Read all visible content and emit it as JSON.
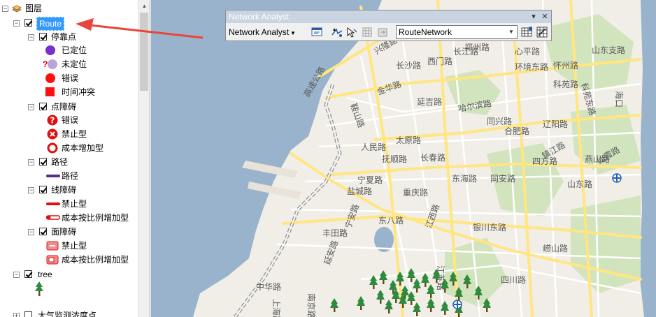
{
  "toc": {
    "root_label": "图层",
    "route_layer": "Route",
    "stops": {
      "label": "停靠点",
      "items": [
        "已定位",
        "未定位",
        "错误",
        "时间冲突"
      ],
      "unlocated_mark": "?"
    },
    "point_barriers": {
      "label": "点障碍",
      "items": [
        "错误",
        "禁止型",
        "成本增加型"
      ]
    },
    "routes": {
      "label": "路径",
      "items": [
        "路径"
      ]
    },
    "line_barriers": {
      "label": "线障碍",
      "items": [
        "禁止型",
        "成本按比例增加型"
      ]
    },
    "polygon_barriers": {
      "label": "面障碍",
      "items": [
        "禁止型",
        "成本按比例增加型"
      ]
    },
    "tree_layer": "tree",
    "air_layer": "大气监测浓度点"
  },
  "toolbar": {
    "title": "Network Analyst",
    "menu_label": "Network Analyst",
    "network_value": "RouteNetwork"
  },
  "map": {
    "road_labels": [
      "长江路",
      "郑州路",
      "心平路",
      "山东支路",
      "兴隆路",
      "长沙路",
      "西门路",
      "环境东路",
      "怀州路",
      "科苑路",
      "科苑东路",
      "海口",
      "金华路",
      "高速公路",
      "鞍山路",
      "延吉路",
      "哈尔滨路",
      "同兴路",
      "合肥路",
      "辽阳路",
      "抚顺路",
      "宁夏路",
      "长春路",
      "四方路",
      "镇江路",
      "燕山路",
      "人民路",
      "太原路",
      "东海路",
      "同安路",
      "山东路",
      "仙霞路",
      "盐城路",
      "重庆路",
      "东八路",
      "丰田路",
      "宁安路",
      "江西路",
      "延安路",
      "南京路",
      "银川东路",
      "崂山路",
      "江苏路",
      "中华路",
      "上海路",
      "四川路"
    ]
  },
  "colors": {
    "water": "#99b3cc",
    "land": "#f1eee8",
    "park": "#d2e4be",
    "road_major": "#ffe680",
    "road_minor": "#ffffff",
    "selection": "#3399ff",
    "arrow": "#e8453c"
  }
}
